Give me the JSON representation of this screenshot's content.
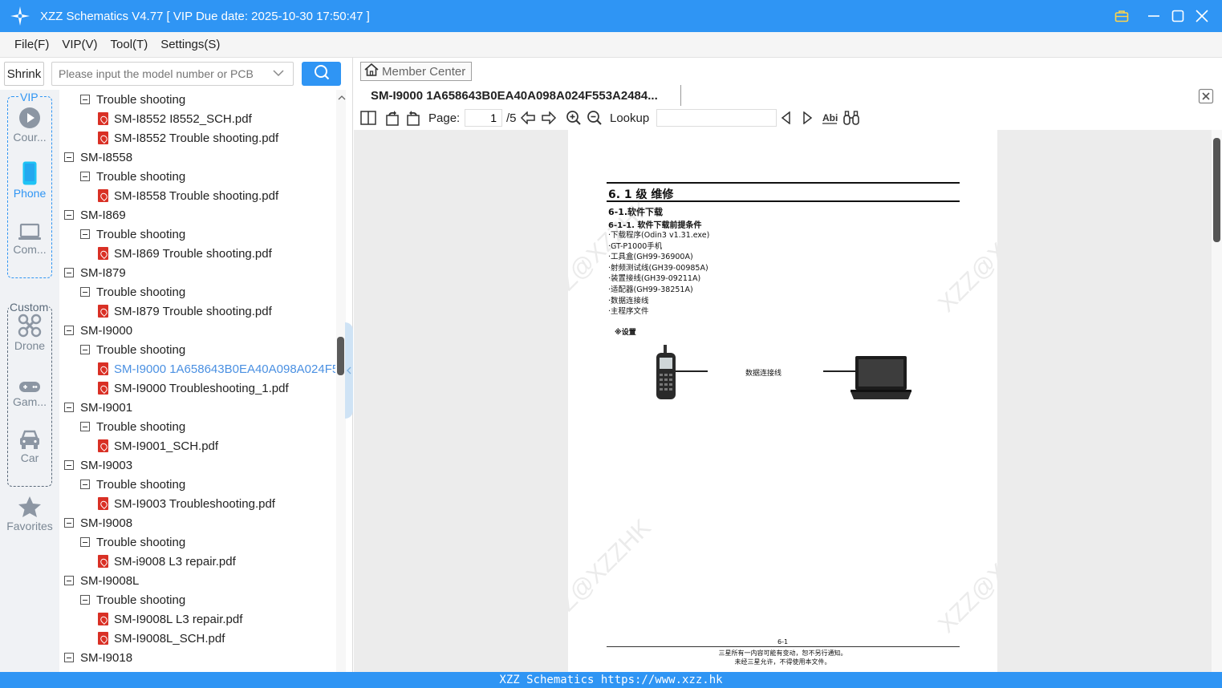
{
  "app": {
    "title": "XZZ Schematics V4.77 [ VIP Due date: 2025-10-30 17:50:47 ]"
  },
  "menu": {
    "file": "File(F)",
    "vip": "VIP(V)",
    "tool": "Tool(T)",
    "settings": "Settings(S)"
  },
  "search": {
    "shrink_label": "Shrink",
    "placeholder": "Please input the model number or PCB"
  },
  "sidebar": {
    "vip_label": "VIP",
    "custom_label": "Custom",
    "items": {
      "courses": "Cour...",
      "phone": "Phone",
      "computer": "Com...",
      "drone": "Drone",
      "game": "Gam...",
      "car": "Car",
      "favorites": "Favorites"
    },
    "active": "Phone",
    "active_color": "#2f95f4"
  },
  "tree": [
    {
      "level": 1,
      "type": "folder",
      "label": "Trouble shooting"
    },
    {
      "level": 2,
      "type": "pdf",
      "label": "SM-I8552 I8552_SCH.pdf"
    },
    {
      "level": 2,
      "type": "pdf",
      "label": "SM-I8552 Trouble shooting.pdf"
    },
    {
      "level": 0,
      "type": "folder",
      "label": "SM-I8558"
    },
    {
      "level": 1,
      "type": "folder",
      "label": "Trouble shooting"
    },
    {
      "level": 2,
      "type": "pdf",
      "label": "SM-I8558 Trouble shooting.pdf"
    },
    {
      "level": 0,
      "type": "folder",
      "label": "SM-I869"
    },
    {
      "level": 1,
      "type": "folder",
      "label": "Trouble shooting"
    },
    {
      "level": 2,
      "type": "pdf",
      "label": "SM-I869 Trouble shooting.pdf"
    },
    {
      "level": 0,
      "type": "folder",
      "label": "SM-I879"
    },
    {
      "level": 1,
      "type": "folder",
      "label": "Trouble shooting"
    },
    {
      "level": 2,
      "type": "pdf",
      "label": "SM-I879 Trouble shooting.pdf"
    },
    {
      "level": 0,
      "type": "folder",
      "label": "SM-I9000"
    },
    {
      "level": 1,
      "type": "folder",
      "label": "Trouble shooting"
    },
    {
      "level": 2,
      "type": "pdf",
      "label": "SM-I9000 1A658643B0EA40A098A024F553A2484...",
      "selected": true
    },
    {
      "level": 2,
      "type": "pdf",
      "label": "SM-I9000 Troubleshooting_1.pdf"
    },
    {
      "level": 0,
      "type": "folder",
      "label": "SM-I9001"
    },
    {
      "level": 1,
      "type": "folder",
      "label": "Trouble shooting"
    },
    {
      "level": 2,
      "type": "pdf",
      "label": "SM-I9001_SCH.pdf"
    },
    {
      "level": 0,
      "type": "folder",
      "label": "SM-I9003"
    },
    {
      "level": 1,
      "type": "folder",
      "label": "Trouble shooting"
    },
    {
      "level": 2,
      "type": "pdf",
      "label": "SM-I9003 Troubleshooting.pdf"
    },
    {
      "level": 0,
      "type": "folder",
      "label": "SM-I9008"
    },
    {
      "level": 1,
      "type": "folder",
      "label": "Trouble shooting"
    },
    {
      "level": 2,
      "type": "pdf",
      "label": "SM-i9008 L3 repair.pdf"
    },
    {
      "level": 0,
      "type": "folder",
      "label": "SM-I9008L"
    },
    {
      "level": 1,
      "type": "folder",
      "label": "Trouble shooting"
    },
    {
      "level": 2,
      "type": "pdf",
      "label": "SM-I9008L L3 repair.pdf"
    },
    {
      "level": 2,
      "type": "pdf",
      "label": "SM-I9008L_SCH.pdf"
    },
    {
      "level": 0,
      "type": "folder",
      "label": "SM-I9018"
    }
  ],
  "viewer": {
    "member_center": "Member Center",
    "doc_tab": "SM-I9000 1A658643B0EA40A098A024F553A2484...",
    "page_label": "Page:",
    "page_value": "1",
    "page_total": "/5",
    "lookup_label": "Lookup"
  },
  "pdf_page": {
    "heading": "6. 1 级 维修",
    "sub1": "6-1.软件下载",
    "sub2": "6-1-1. 软件下载前提条件",
    "lines": [
      "·下载程序(Odin3 v1.31.exe)",
      "·GT-P1000手机",
      "·工具盒(GH99-36900A)",
      "·射频测试线(GH39-00985A)",
      "·装置接线(GH39-09211A)",
      "·适配器(GH99-38251A)",
      "·数据连接线",
      "·主程序文件"
    ],
    "setup": "※设置",
    "cable": "数据连接线",
    "page_num": "6-1",
    "footer1": "三星所有一内容可能有变动，恕不另行通知。",
    "footer2": "未经三星允许，不得使用本文件。",
    "watermark": "XZZ@XZZHK"
  },
  "status": {
    "text": "XZZ Schematics https://www.xzz.hk"
  }
}
